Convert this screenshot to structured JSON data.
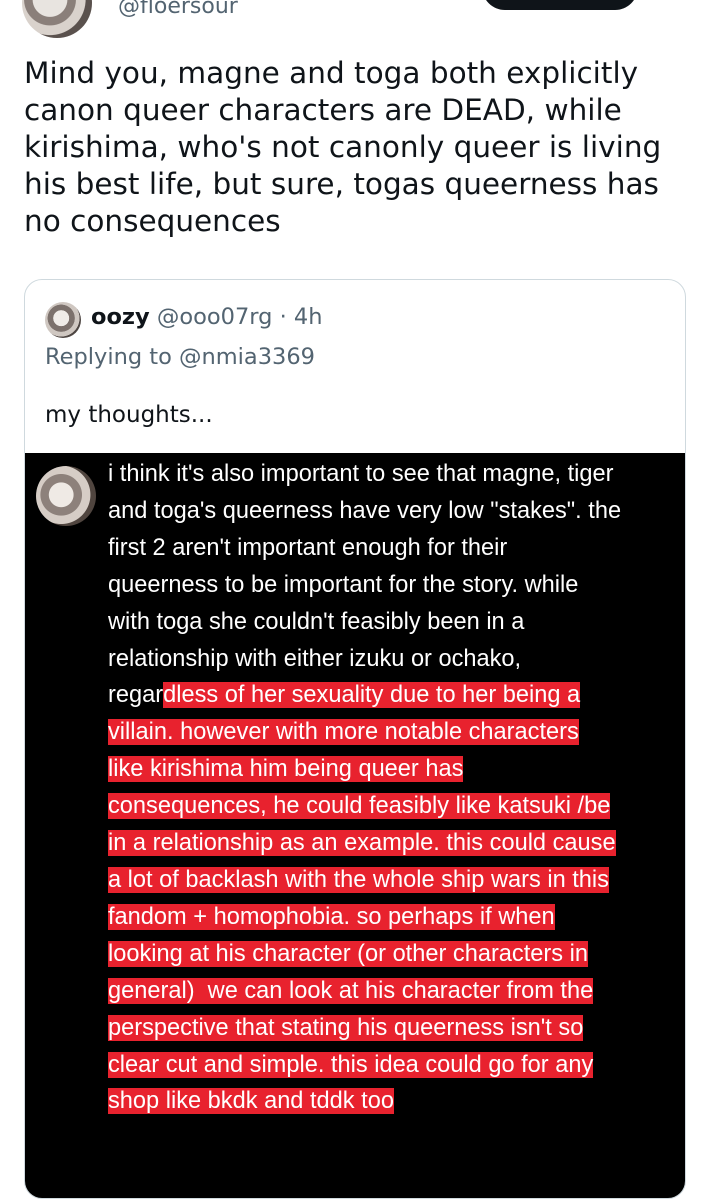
{
  "author": {
    "handle": "@floersour"
  },
  "tweet": {
    "text": "Mind you, magne and toga both explicitly canon queer characters are DEAD, while kirishima, who's not canonly queer is living his best life, but sure, togas queerness has no consequences"
  },
  "quoted": {
    "name": "oozy",
    "handle": "@ooo07rg",
    "separator": " · ",
    "time": "4h",
    "replying_to": "Replying to @nmia3369",
    "text": "my thoughts...",
    "image_comment": {
      "plain": "i think it's also important to see that magne, tiger\nand toga's queerness have very low \"stakes\". the\nfirst 2 aren't important enough for their\nqueerness to be important for the story. while\nwith toga she couldn't feasibly been in a\nrelationship with either izuku or ochako,\nregar",
      "highlighted": "dless of her sexuality due to her being a\nvillain. however with more notable characters\nlike kirishima him being queer has\nconsequences, he could feasibly like katsuki /be\nin a relationship as an example. this could cause\na lot of backlash with the whole ship wars in this\nfandom + homophobia. so perhaps if when\nlooking at his character (or other characters in\ngeneral)  we can look at his character from the\nperspective that stating his queerness isn't so\nclear cut and simple. this idea could go for any\nshop like bkdk and tddk too",
      "highlight_color": "#e8222e"
    }
  },
  "colors": {
    "text_primary": "#0f1419",
    "text_secondary": "#536471",
    "border": "#cfd9de"
  }
}
